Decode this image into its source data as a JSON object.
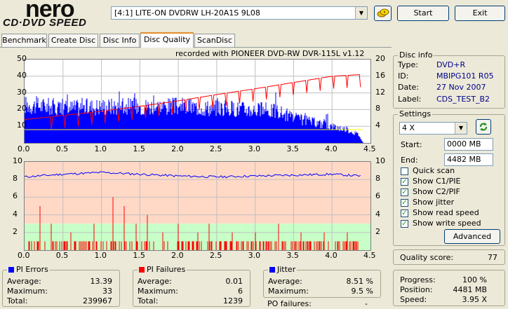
{
  "brand": {
    "name": "nero",
    "sub": "CD·DVD SPEED"
  },
  "toolbar": {
    "drive": "[4:1]  LITE-ON DVDRW LH-20A1S 9L08",
    "start_label": "Start",
    "exit_label": "Exit",
    "refresh_icon": "refresh-drive-icon"
  },
  "tabs": [
    {
      "label": "Benchmark"
    },
    {
      "label": "Create Disc"
    },
    {
      "label": "Disc Info"
    },
    {
      "label": "Disc Quality",
      "active": true
    },
    {
      "label": "ScanDisc"
    }
  ],
  "chart_top_caption": "recorded with PIONEER DVD-RW  DVR-115L v1.12",
  "chart_data": [
    {
      "type": "bar",
      "name": "PI errors / read speed",
      "x_ticks": [
        "0.0",
        "0.5",
        "1.0",
        "1.5",
        "2.0",
        "2.5",
        "3.0",
        "3.5",
        "4.0",
        "4.5"
      ],
      "xlim": [
        0,
        4.5
      ],
      "y_left_ticks": [
        "50",
        "40",
        "30",
        "20",
        "10"
      ],
      "ylim_left": [
        0,
        50
      ],
      "y_right_ticks": [
        "20",
        "16",
        "12",
        "8",
        "4"
      ],
      "ylim_right": [
        0,
        20
      ],
      "pi_errors_profile": [
        [
          0,
          23
        ],
        [
          0.3,
          22
        ],
        [
          0.6,
          21
        ],
        [
          1.0,
          22
        ],
        [
          1.5,
          22
        ],
        [
          2.0,
          22
        ],
        [
          2.5,
          21
        ],
        [
          3.0,
          20
        ],
        [
          3.3,
          19
        ],
        [
          3.5,
          15
        ],
        [
          3.8,
          12
        ],
        [
          4.0,
          10
        ],
        [
          4.2,
          8
        ],
        [
          4.35,
          5
        ],
        [
          4.4,
          0
        ]
      ],
      "read_speed": [
        [
          0,
          5.6
        ],
        [
          0.5,
          6.6
        ],
        [
          1.0,
          7.6
        ],
        [
          1.5,
          8.8
        ],
        [
          2.0,
          10.1
        ],
        [
          2.5,
          11.6
        ],
        [
          3.0,
          13.0
        ],
        [
          3.5,
          14.5
        ],
        [
          4.0,
          16.0
        ],
        [
          4.37,
          16.4
        ]
      ],
      "colors": {
        "errors": "#0000ff",
        "speed": "#ff0000",
        "marker": "#ffff00"
      }
    },
    {
      "type": "bar",
      "name": "PI failures / jitter",
      "x_ticks": [
        "0.0",
        "0.5",
        "1.0",
        "1.5",
        "2.0",
        "2.5",
        "3.0",
        "3.5",
        "4.0",
        "4.5"
      ],
      "xlim": [
        0,
        4.5
      ],
      "y_left_ticks": [
        "10",
        "8",
        "6",
        "4",
        "2"
      ],
      "ylim_left": [
        0,
        10
      ],
      "y_right_ticks": [
        "10",
        "8",
        "6",
        "4",
        "2"
      ],
      "ylim_right": [
        0,
        10
      ],
      "jitter": [
        [
          0,
          8.3
        ],
        [
          0.5,
          8.6
        ],
        [
          1.0,
          8.8
        ],
        [
          1.5,
          8.6
        ],
        [
          2.0,
          8.4
        ],
        [
          2.5,
          8.3
        ],
        [
          3.0,
          8.4
        ],
        [
          3.5,
          8.5
        ],
        [
          4.0,
          8.6
        ],
        [
          4.37,
          8.4
        ]
      ],
      "pi_failure_spikes": [
        [
          0.2,
          5
        ],
        [
          0.35,
          3
        ],
        [
          0.6,
          2
        ],
        [
          0.9,
          3
        ],
        [
          1.15,
          6
        ],
        [
          1.3,
          5
        ],
        [
          1.45,
          3
        ],
        [
          1.6,
          4
        ],
        [
          1.8,
          2
        ],
        [
          2.0,
          3
        ],
        [
          2.25,
          2
        ],
        [
          2.4,
          3
        ],
        [
          2.7,
          2
        ],
        [
          3.0,
          2
        ],
        [
          3.3,
          3
        ],
        [
          3.6,
          2
        ],
        [
          3.9,
          2
        ],
        [
          4.2,
          2
        ]
      ],
      "colors": {
        "failures": "#ff0000",
        "jitter": "#0000ff",
        "bg_high": "#ffd9c6",
        "bg_low": "#c8ffc8"
      }
    }
  ],
  "disc_info": {
    "title": "Disc info",
    "rows": [
      {
        "label": "Type:",
        "value": "DVD+R"
      },
      {
        "label": "ID:",
        "value": "MBIPG101 R05"
      },
      {
        "label": "Date:",
        "value": "27 Nov 2007"
      },
      {
        "label": "Label:",
        "value": "CDS_TEST_B2"
      }
    ]
  },
  "settings": {
    "title": "Settings",
    "speed": "4 X",
    "start_label": "Start:",
    "start_value": "0000 MB",
    "end_label": "End:",
    "end_value": "4482 MB",
    "checks": [
      {
        "label": "Quick scan",
        "checked": false
      },
      {
        "label": "Show C1/PIE",
        "checked": true
      },
      {
        "label": "Show C2/PIF",
        "checked": true
      },
      {
        "label": "Show jitter",
        "checked": true
      },
      {
        "label": "Show read speed",
        "checked": true
      },
      {
        "label": "Show write speed",
        "checked": true
      }
    ],
    "advanced_label": "Advanced"
  },
  "quality": {
    "label": "Quality score:",
    "value": "77"
  },
  "progress": {
    "rows": [
      {
        "label": "Progress:",
        "value": "100 %"
      },
      {
        "label": "Position:",
        "value": "4481 MB"
      },
      {
        "label": "Speed:",
        "value": "3.95 X"
      }
    ]
  },
  "pi_errors": {
    "title": "PI Errors",
    "color": "#0000ff",
    "rows": [
      {
        "label": "Average:",
        "value": "13.39"
      },
      {
        "label": "Maximum:",
        "value": "33"
      },
      {
        "label": "Total:",
        "value": "239967"
      }
    ]
  },
  "pi_failures": {
    "title": "PI Failures",
    "color": "#ff0000",
    "rows": [
      {
        "label": "Average:",
        "value": "0.01"
      },
      {
        "label": "Maximum:",
        "value": "6"
      },
      {
        "label": "Total:",
        "value": "1239"
      }
    ]
  },
  "jitter": {
    "title": "Jitter",
    "color": "#0000ff",
    "rows": [
      {
        "label": "Average:",
        "value": "8.51 %"
      },
      {
        "label": "Maximum:",
        "value": "9.5 %"
      }
    ],
    "po_label": "PO failures:",
    "po_value": "-"
  }
}
